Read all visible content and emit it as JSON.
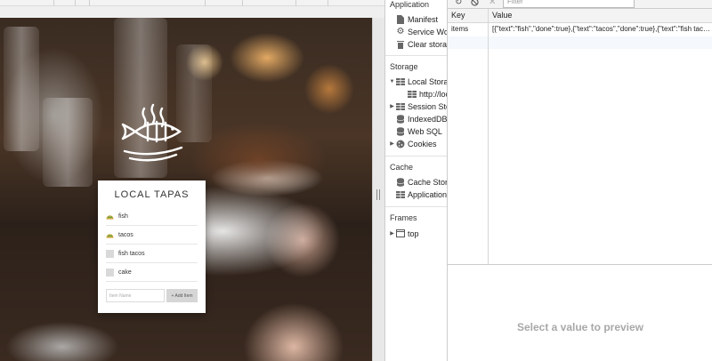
{
  "app": {
    "title": "LOCAL TAPAS",
    "items": [
      {
        "text": "fish",
        "done": true
      },
      {
        "text": "tacos",
        "done": true
      },
      {
        "text": "fish tacos",
        "done": false
      },
      {
        "text": "cake",
        "done": false
      }
    ],
    "input_placeholder": "Item Name",
    "add_button_label": "+ Add Item",
    "done_emoji": "🌮"
  },
  "devtools": {
    "sections": {
      "application": {
        "title": "Application",
        "items": [
          {
            "label": "Manifest",
            "icon": "document-icon"
          },
          {
            "label": "Service Workers",
            "icon": "gear-icon"
          },
          {
            "label": "Clear storage",
            "icon": "trash-icon"
          }
        ]
      },
      "storage": {
        "title": "Storage",
        "items": [
          {
            "label": "Local Storage",
            "icon": "grid-icon",
            "expanded": true
          },
          {
            "label": "http://localhost",
            "icon": "grid-icon",
            "selected": true
          },
          {
            "label": "Session Storage",
            "icon": "grid-icon",
            "expanded": false
          },
          {
            "label": "IndexedDB",
            "icon": "database-icon"
          },
          {
            "label": "Web SQL",
            "icon": "database-icon"
          },
          {
            "label": "Cookies",
            "icon": "cookie-icon",
            "expanded": false
          }
        ]
      },
      "cache": {
        "title": "Cache",
        "items": [
          {
            "label": "Cache Storage",
            "icon": "database-icon"
          },
          {
            "label": "Application Cache",
            "icon": "grid-icon"
          }
        ]
      },
      "frames": {
        "title": "Frames",
        "items": [
          {
            "label": "top",
            "icon": "frame-icon",
            "expanded": false
          }
        ]
      }
    },
    "toolbar": {
      "filter_placeholder": "Filter",
      "refresh_glyph": "↻",
      "block_glyph": "⃠",
      "delete_glyph": "✕"
    },
    "table": {
      "columns": [
        "Key",
        "Value"
      ],
      "rows": [
        {
          "key": "items",
          "value": "[{\"text\":\"fish\",\"done\":true},{\"text\":\"tacos\",\"done\":true},{\"text\":\"fish tacos\",\"done\":false},{\"text\":\"cake\",\"done\":false}]"
        }
      ]
    },
    "preview_empty_text": "Select a value to preview"
  }
}
